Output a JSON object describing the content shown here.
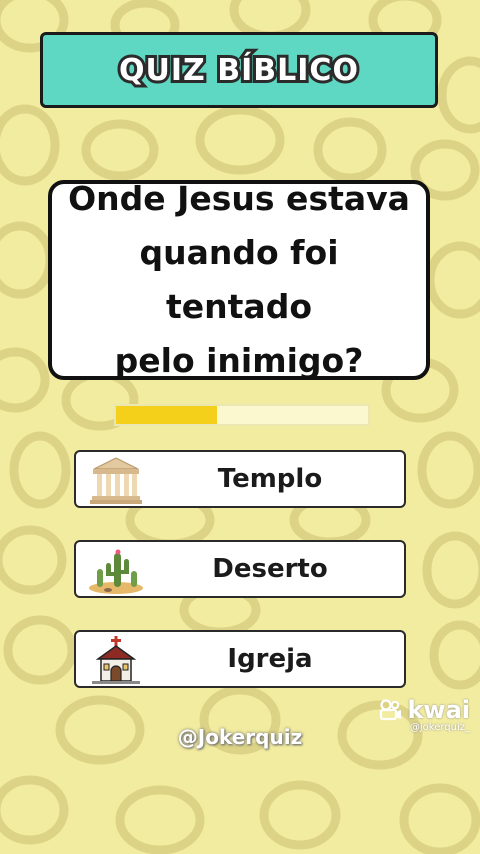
{
  "header": {
    "title": "QUIZ BÍBLICO"
  },
  "question": {
    "lines": [
      "Onde Jesus estava",
      "quando foi tentado",
      "pelo inimigo?"
    ]
  },
  "timer": {
    "progress": 0.4
  },
  "answers": [
    {
      "label": "Templo",
      "icon": "temple-icon"
    },
    {
      "label": "Deserto",
      "icon": "desert-cactus-icon"
    },
    {
      "label": "Igreja",
      "icon": "church-icon"
    }
  ],
  "watermark": {
    "handle": "@Jokerquiz",
    "kwai_brand": "kwai",
    "kwai_user": "@jokerquiz_"
  },
  "colors": {
    "background": "#f2eca0",
    "banner": "#5fd8c3",
    "timer_fill": "#f5d01a"
  }
}
